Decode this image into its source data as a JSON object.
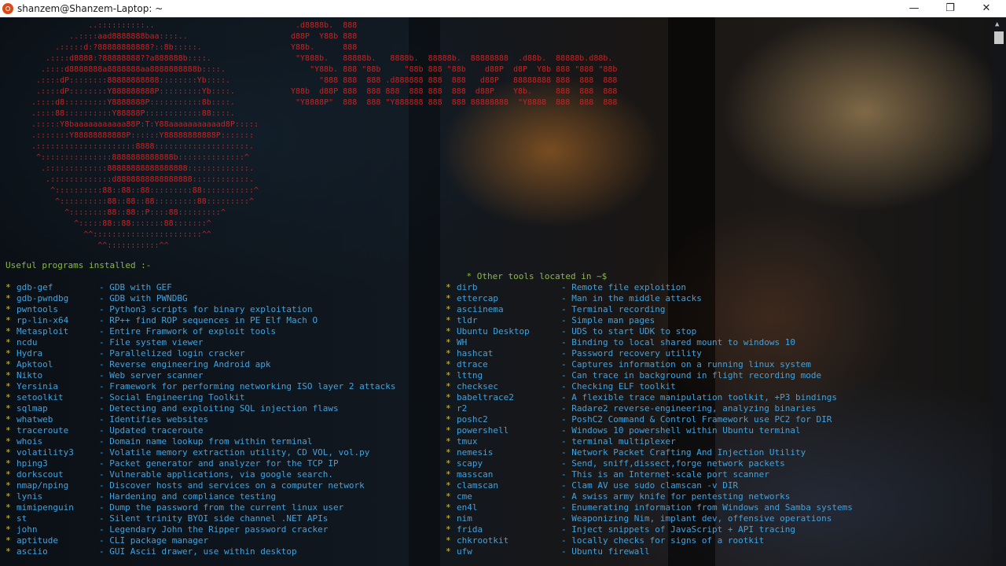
{
  "window": {
    "title": "shanzem@Shanzem-Laptop: ~",
    "icon": "ubuntu-icon",
    "buttons": {
      "minimize": "—",
      "maximize": "❐",
      "close": "✕"
    }
  },
  "banner": {
    "left_art": "            ..::::::::::..\n        ..::::aad8888888baa::::..\n     .:::::d:?88888888888?::8b:::::.\n   .::::d8888:?88888888??a888888b::::.\n  .::::d8888888a8888888aa8888888888b::::.\n .::::dP::::::::88888888888::::::::Yb::::.\n .::::dP::::::::Y888888888P:::::::::Yb::::.\n.::::d8:::::::::Y8888888P:::::::::::8b::::.\n.::::88::::::::::Y88888P::::::::::::88::::.\n.:::::Y8baaaaaaaaaaa88P:T:Y88aaaaaaaaaaad8P:::::\n.:::::::Y88888888888P::::::Y88888888888P:::::::\n.:::::::::::::::::::::8888::::::::::::::::::::.\n ^:::::::::::::::8888888888888b::::::::::::::^\n  .:::::::::::::88888888888888888:::::::::::::.\n   .:::::::::::::d8888888888888888::::::::::::.\n    ^::::::::::88::88::88:::::::::88:::::::::::^\n     ^::::::::::88::88::88:::::::::88:::::::::^\n       ^::::::::88::88::P::::88:::::::::^\n         ^:::::88::88:::::::88:::::::^\n           ^^:::::::::::::::::::::::^^\n              ^^:::::::::::^^",
    "right_art": " .d8888b.  888\nd88P  Y88b 888\nY88b.      888\n \"Y888b.   88888b.   8888b.  88888b.  88888888  .d88b.  88888b.d88b.\n    \"Y88b. 888 \"88b     \"88b 888 \"88b    d88P  d8P  Y8b 888 \"888 \"88b\n      \"888 888  888 .d888888 888  888   d88P   88888888 888  888  888\nY88b  d88P 888  888 888  888 888  888  d88P    Y8b.     888  888  888\n \"Y8888P\"  888  888 \"Y888888 888  888 88888888  \"Y8888  888  888  888"
  },
  "left_panel": {
    "heading": "Useful programs installed :-",
    "items": [
      {
        "name": "gdb-gef",
        "desc": "GDB with GEF"
      },
      {
        "name": "gdb-pwndbg",
        "desc": "GDB with PWNDBG"
      },
      {
        "name": "pwntools",
        "desc": "Python3 scripts for binary exploitation"
      },
      {
        "name": "rp-lin-x64",
        "desc": "RP++ find ROP sequences in PE Elf Mach O"
      },
      {
        "name": "Metasploit",
        "desc": "Entire Framwork of exploit tools"
      },
      {
        "name": "ncdu",
        "desc": "File system viewer"
      },
      {
        "name": "Hydra",
        "desc": "Parallelized login cracker"
      },
      {
        "name": "Apktool",
        "desc": "Reverse engineering Android apk"
      },
      {
        "name": "Nikto",
        "desc": "Web server scanner"
      },
      {
        "name": "Yersinia",
        "desc": "Framework for performing networking ISO layer 2 attacks"
      },
      {
        "name": "setoolkit",
        "desc": "Social Engineering Toolkit"
      },
      {
        "name": "sqlmap",
        "desc": "Detecting and exploiting SQL injection flaws"
      },
      {
        "name": "whatweb",
        "desc": "Identifies websites"
      },
      {
        "name": "traceroute",
        "desc": "Updated traceroute"
      },
      {
        "name": "whois",
        "desc": "Domain name lookup from within terminal"
      },
      {
        "name": "volatility3",
        "desc": "Volatile memory extraction utility, CD VOL, vol.py"
      },
      {
        "name": "hping3",
        "desc": "Packet generator and analyzer for the TCP IP"
      },
      {
        "name": "dorkscout",
        "desc": "Vulnerable applications, via google search."
      },
      {
        "name": "nmap/nping",
        "desc": "Discover hosts and services on a computer network"
      },
      {
        "name": "lynis",
        "desc": "Hardening and compliance testing"
      },
      {
        "name": "mimipenguin",
        "desc": "Dump the password from the current linux user"
      },
      {
        "name": "st",
        "desc": "Silent trinity BYOI side channel .NET APIs"
      },
      {
        "name": "john",
        "desc": "Legendary John the Ripper password cracker"
      },
      {
        "name": "aptitude",
        "desc": "CLI package manager"
      },
      {
        "name": "asciio",
        "desc": "GUI Ascii drawer, use within desktop"
      }
    ]
  },
  "right_panel": {
    "heading": "* Other tools located in ~$",
    "items": [
      {
        "name": "dirb",
        "desc": "Remote file exploition"
      },
      {
        "name": "ettercap",
        "desc": "Man in the middle attacks"
      },
      {
        "name": "asciinema",
        "desc": "Terminal recording"
      },
      {
        "name": "tldr",
        "desc": "Simple man pages"
      },
      {
        "name": "Ubuntu Desktop",
        "desc": "UDS to start UDK to stop"
      },
      {
        "name": "WH",
        "desc": "Binding to local shared mount to windows 10"
      },
      {
        "name": "hashcat",
        "desc": "Password recovery utility"
      },
      {
        "name": "dtrace",
        "desc": "Captures information on a running linux system"
      },
      {
        "name": "lttng",
        "desc": "Can trace in background in flight recording mode"
      },
      {
        "name": "checksec",
        "desc": "Checking ELF toolkit"
      },
      {
        "name": "babeltrace2",
        "desc": "A flexible trace manipulation toolkit, +P3 bindings"
      },
      {
        "name": "r2",
        "desc": "Radare2 reverse-engineering, analyzing binaries"
      },
      {
        "name": "poshc2",
        "desc": "PoshC2 Command & Control Framework use PC2 for DIR"
      },
      {
        "name": "powershell",
        "desc": "Windows 10 powershell within Ubuntu terminal"
      },
      {
        "name": "tmux",
        "desc": "terminal multiplexer"
      },
      {
        "name": "nemesis",
        "desc": "Network Packet Crafting And Injection Utility"
      },
      {
        "name": "scapy",
        "desc": "Send, sniff,dissect,forge network packets"
      },
      {
        "name": "masscan",
        "desc": "This is an Internet-scale port scanner"
      },
      {
        "name": "clamscan",
        "desc": "Clam AV use sudo clamscan -v DIR"
      },
      {
        "name": "cme",
        "desc": "A swiss army knife for pentesting networks"
      },
      {
        "name": "en4l",
        "desc": "Enumerating information from Windows and Samba systems"
      },
      {
        "name": "nim",
        "desc": "Weaponizing Nim, implant dev, offensive operations"
      },
      {
        "name": "frida",
        "desc": "Inject snippets of JavaScript + API tracing"
      },
      {
        "name": "chkrootkit",
        "desc": "locally checks for signs of a rootkit"
      },
      {
        "name": "ufw",
        "desc": "Ubuntu firewall"
      }
    ]
  },
  "colors": {
    "art": "#c42626",
    "heading": "#8ab84a",
    "items": "#3fa3e0",
    "star": "#d9c24a"
  }
}
